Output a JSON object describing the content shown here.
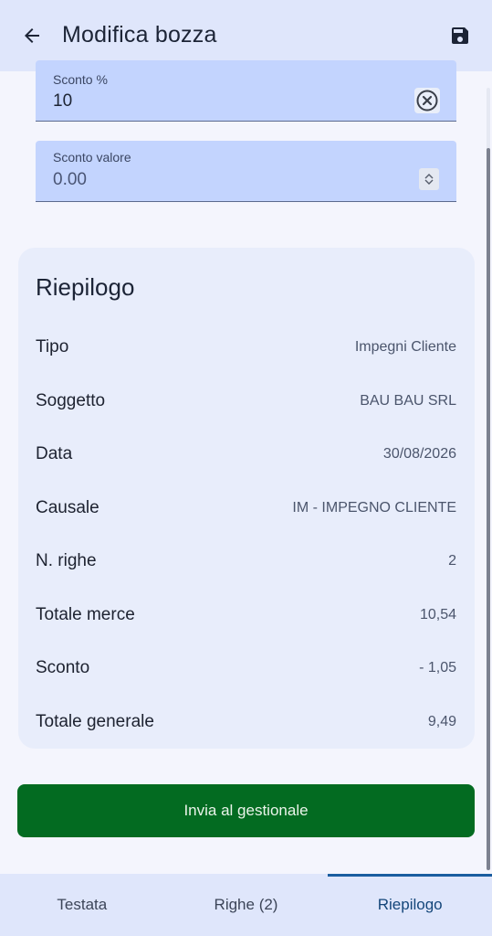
{
  "header": {
    "title": "Modifica bozza",
    "back_icon": "arrow-left-icon",
    "save_icon": "floppy-disk-icon"
  },
  "fields": {
    "discount_percent": {
      "label": "Sconto %",
      "value": "10"
    },
    "discount_value": {
      "label": "Sconto valore",
      "value": "0.00"
    }
  },
  "summary": {
    "title": "Riepilogo",
    "rows": [
      {
        "label": "Tipo",
        "value": "Impegni Cliente"
      },
      {
        "label": "Soggetto",
        "value": "BAU BAU SRL"
      },
      {
        "label": "Data",
        "value": "30/08/2026"
      },
      {
        "label": "Causale",
        "value": "IM - IMPEGNO CLIENTE"
      },
      {
        "label": "N. righe",
        "value": "2"
      },
      {
        "label": "Totale merce",
        "value": "10,54"
      },
      {
        "label": "Sconto",
        "value": "- 1,05"
      },
      {
        "label": "Totale generale",
        "value": "9,49"
      }
    ]
  },
  "actions": {
    "send_label": "Invia al gestionale"
  },
  "tabs": [
    {
      "label": "Testata",
      "active": false
    },
    {
      "label": "Righe (2)",
      "active": false
    },
    {
      "label": "Riepilogo",
      "active": true
    }
  ],
  "colors": {
    "appbar": "#dfe6fb",
    "field_bg": "#c3d4fe",
    "card_bg": "#e8edfb",
    "primary_button": "#036b21",
    "active_tab": "#1a5da0"
  }
}
